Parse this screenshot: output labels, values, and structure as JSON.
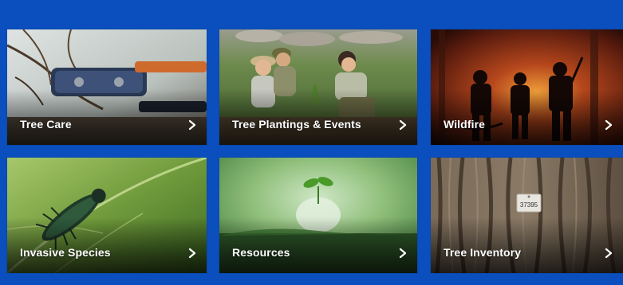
{
  "background_color": "#0a4fbd",
  "cards": [
    {
      "label": "Tree Care",
      "icon": "chevron-right-icon"
    },
    {
      "label": "Tree Plantings & Events",
      "icon": "chevron-right-icon"
    },
    {
      "label": "Wildfire",
      "icon": "chevron-right-icon"
    },
    {
      "label": "Invasive Species",
      "icon": "chevron-right-icon"
    },
    {
      "label": "Resources",
      "icon": "chevron-right-icon"
    },
    {
      "label": "Tree Inventory",
      "icon": "chevron-right-icon",
      "tag_number": "37395"
    }
  ]
}
